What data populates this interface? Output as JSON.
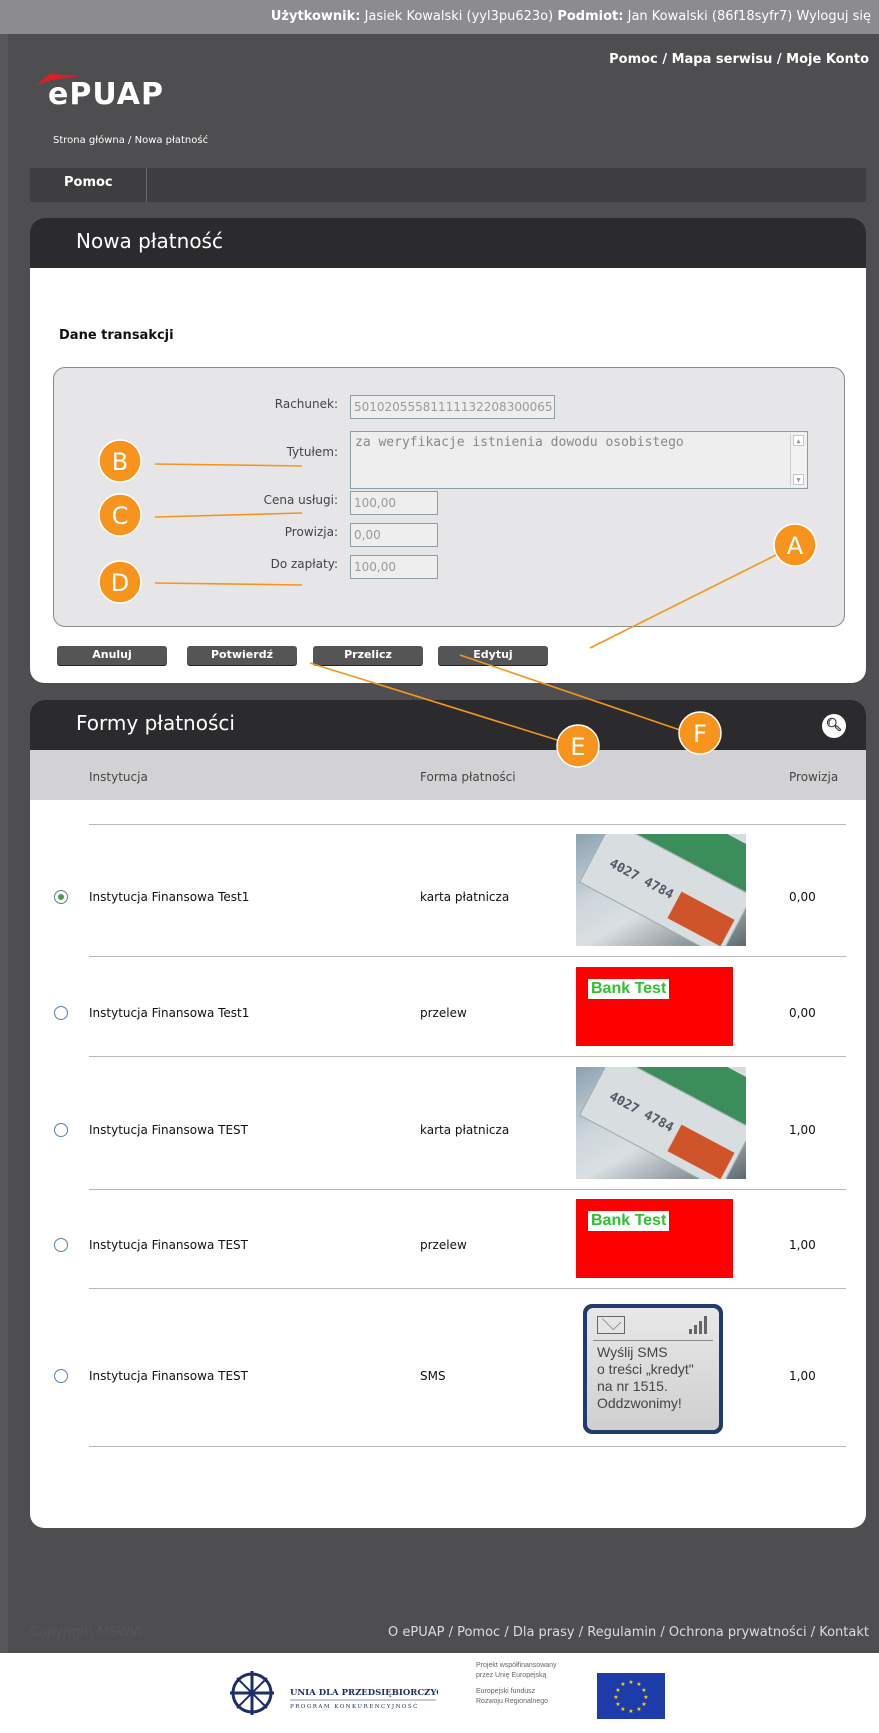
{
  "userbar": {
    "user_label": "Użytkownik:",
    "user_value": "Jasiek Kowalski (yyl3pu623o)",
    "subject_label": "Podmiot:",
    "subject_value": "Jan Kowalski (86f18syfr7)",
    "logout": "Wyloguj się"
  },
  "header": {
    "help": "Pomoc",
    "sitemap": "Mapa serwisu",
    "account": "Moje Konto",
    "sep": "/",
    "logo_text": "ePUAP",
    "breadcrumb": "Strona główna / Nowa płatność"
  },
  "tabs": {
    "help": "Pomoc"
  },
  "payment": {
    "title": "Nowa płatność",
    "section_title": "Dane transakcji",
    "fields": {
      "account_label": "Rachunek:",
      "account_value": "50102055581111132208300065",
      "title_label": "Tytułem:",
      "title_value": "za weryfikacje istnienia dowodu osobistego",
      "price_label": "Cena usługi:",
      "price_value": "100,00",
      "fee_label": "Prowizja:",
      "fee_value": "0,00",
      "total_label": "Do zapłaty:",
      "total_value": "100,00"
    },
    "buttons": {
      "cancel": "Anuluj",
      "confirm": "Potwierdź",
      "recalc": "Przelicz",
      "edit": "Edytuj"
    }
  },
  "methods": {
    "title": "Formy płatności",
    "columns": {
      "institution": "Instytucja",
      "method": "Forma płatności",
      "fee": "Prowizja"
    },
    "rows": [
      {
        "institution": "Instytucja Finansowa Test1",
        "method": "karta płatnicza",
        "fee": "0,00",
        "selected": true,
        "image": "card"
      },
      {
        "institution": "Instytucja Finansowa Test1",
        "method": "przelew",
        "fee": "0,00",
        "selected": false,
        "image": "bank"
      },
      {
        "institution": "Instytucja Finansowa TEST",
        "method": "karta płatnicza",
        "fee": "1,00",
        "selected": false,
        "image": "card"
      },
      {
        "institution": "Instytucja Finansowa TEST",
        "method": "przelew",
        "fee": "1,00",
        "selected": false,
        "image": "bank"
      },
      {
        "institution": "Instytucja Finansowa TEST",
        "method": "SMS",
        "fee": "1,00",
        "selected": false,
        "image": "sms"
      }
    ],
    "card_number": "4027 4784",
    "bank_text": "Bank Test",
    "sms_lines": [
      "Wyślij SMS",
      "o treści „kredyt\"",
      "na nr 1515.",
      "Oddzwonimy!"
    ]
  },
  "annotations": {
    "labels": [
      "A",
      "B",
      "C",
      "D",
      "E",
      "F"
    ],
    "color": "#f7941d"
  },
  "footer": {
    "copyright": "Copyright MSWiA",
    "links": "O ePUAP / Pomoc / Dla prasy / Regulamin / Ochrona prywatności / Kontakt"
  },
  "bottom": {
    "union_title": "UNIA DLA PRZEDSIĘBIORCZYCH",
    "union_sub": "PROGRAM KONKURENCYJNOŚĆ",
    "project_lines": [
      "Projekt współfinansowany",
      "przez Unię Europejską"
    ],
    "fund_lines": [
      "Europejski fundusz",
      "Rozwoju Regionalnego"
    ]
  }
}
